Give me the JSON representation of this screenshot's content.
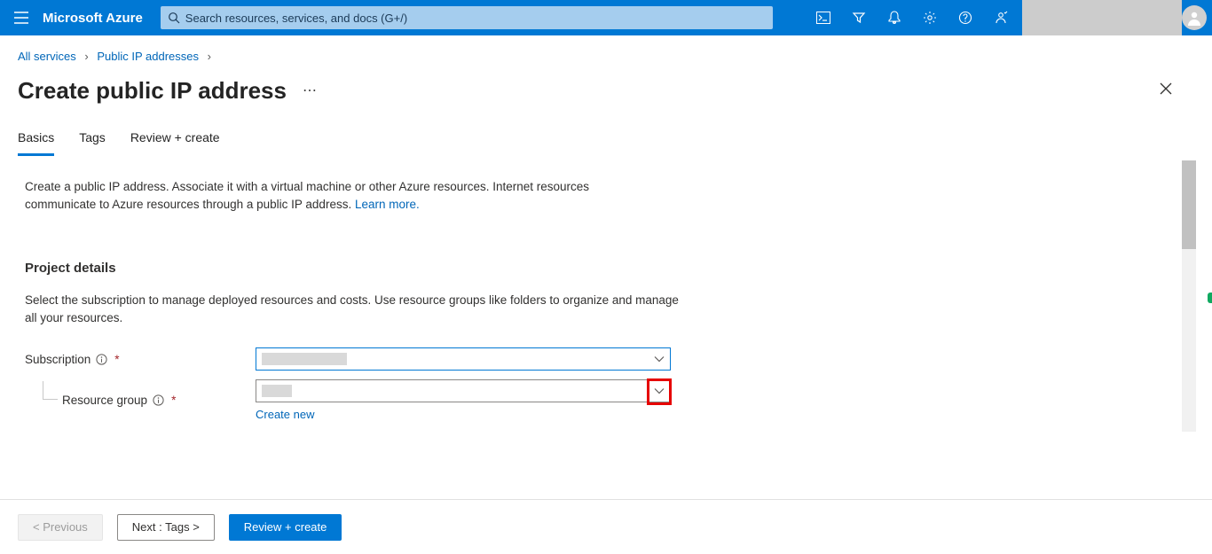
{
  "topbar": {
    "brand": "Microsoft Azure",
    "search_placeholder": "Search resources, services, and docs (G+/)"
  },
  "breadcrumb": {
    "items": [
      {
        "label": "All services"
      },
      {
        "label": "Public IP addresses"
      }
    ]
  },
  "page": {
    "title": "Create public IP address"
  },
  "tabs": [
    {
      "label": "Basics",
      "active": true
    },
    {
      "label": "Tags",
      "active": false
    },
    {
      "label": "Review + create",
      "active": false
    }
  ],
  "intro": {
    "text": "Create a public IP address. Associate it with a virtual machine or other Azure resources. Internet resources communicate to Azure resources through a public IP address.",
    "learn_more": "Learn more."
  },
  "project_details": {
    "heading": "Project details",
    "desc": "Select the subscription to manage deployed resources and costs. Use resource groups like folders to organize and manage all your resources.",
    "subscription_label": "Subscription",
    "resource_group_label": "Resource group",
    "create_new": "Create new"
  },
  "footer": {
    "previous": "< Previous",
    "next": "Next : Tags >",
    "review": "Review + create"
  }
}
